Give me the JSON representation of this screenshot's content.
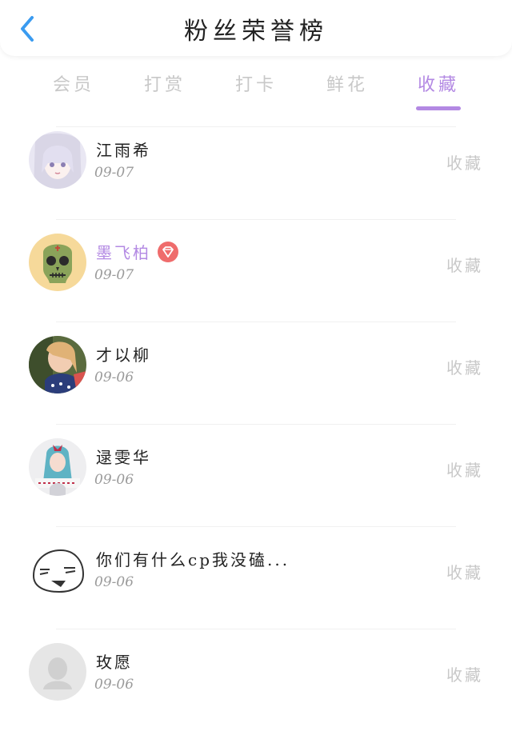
{
  "header": {
    "title": "粉丝荣誉榜"
  },
  "tabs": [
    {
      "label": "会员"
    },
    {
      "label": "打赏"
    },
    {
      "label": "打卡"
    },
    {
      "label": "鲜花"
    },
    {
      "label": "收藏"
    }
  ],
  "active_tab": "收藏",
  "colors": {
    "accent": "#b389e3",
    "muted": "#c8c8c8",
    "back": "#3a9bf0",
    "badge": "#ef6c6c"
  },
  "rows": [
    {
      "name": "江雨希",
      "date": "09-07",
      "action": "收藏"
    },
    {
      "name": "墨飞柏",
      "date": "09-07",
      "action": "收藏"
    },
    {
      "name": "才以柳",
      "date": "09-06",
      "action": "收藏"
    },
    {
      "name": "逯雯华",
      "date": "09-06",
      "action": "收藏"
    },
    {
      "name": "你们有什么cp我没磕...",
      "date": "09-06",
      "action": "收藏"
    },
    {
      "name": "玫愿",
      "date": "09-06",
      "action": "收藏"
    }
  ]
}
